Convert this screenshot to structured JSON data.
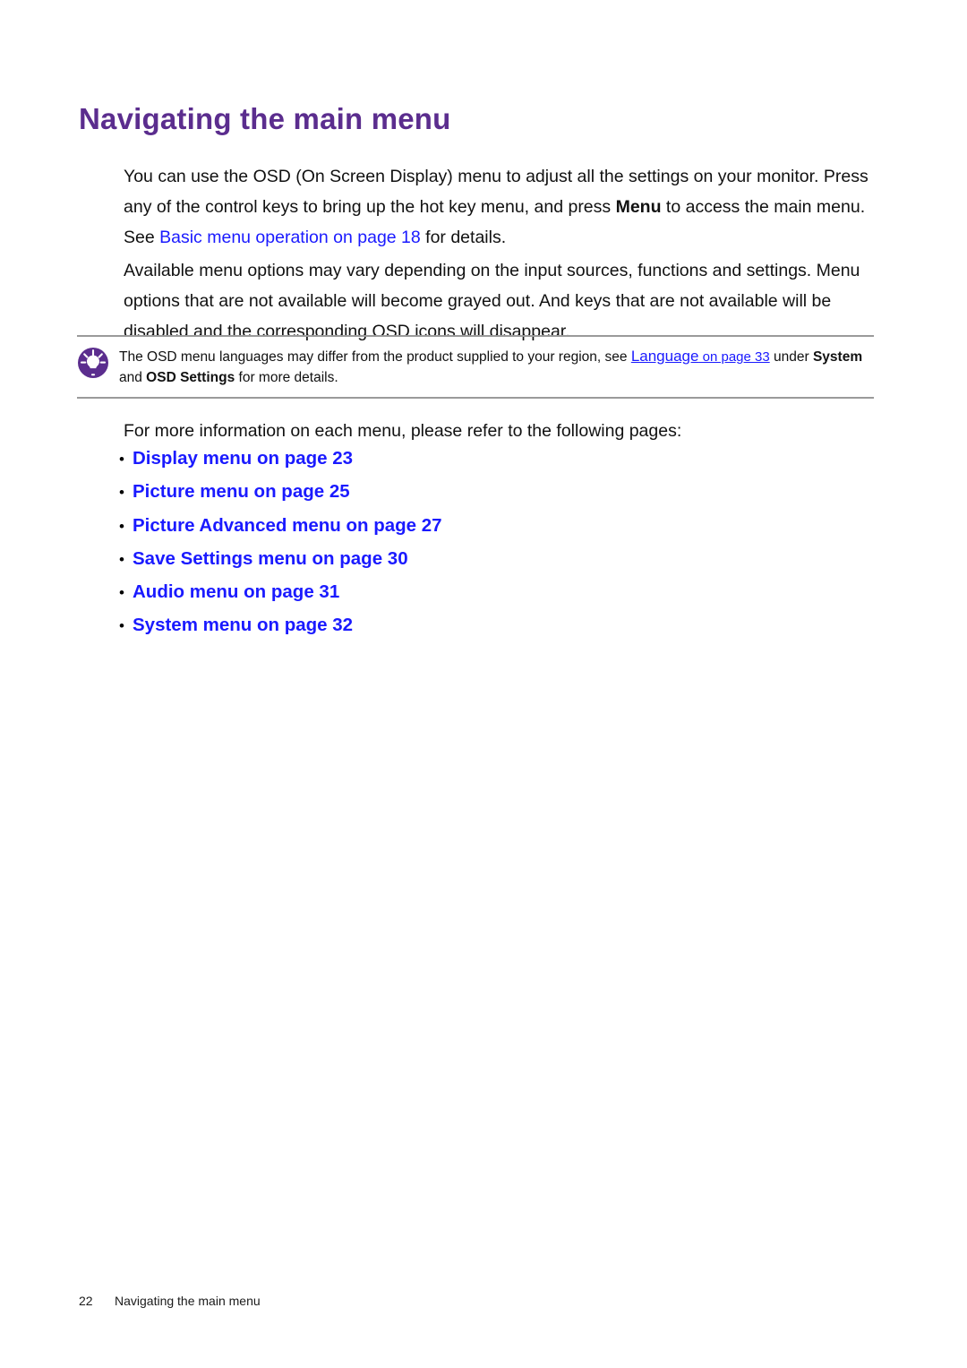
{
  "document": {
    "title": "Navigating the main menu",
    "title_color": "#5b2d8e",
    "link_color": "#1a1aff"
  },
  "intro": {
    "part1": "You can use the OSD (On Screen Display) menu to adjust all the settings on your monitor. Press any of the control keys to bring up the hot key menu, and press ",
    "bold_menu": "Menu",
    "part2": " to access the main menu. See ",
    "link": "Basic menu operation on page 18",
    "part3": " for details."
  },
  "availability": {
    "text": "Available menu options may vary depending on the input sources, functions and settings. Menu options that are not available will become grayed out. And keys that are not available will be disabled and the corresponding OSD icons will disappear."
  },
  "note": {
    "icon": "lightbulb-tip-icon",
    "icon_color": "#5b2d8e",
    "part1": "The OSD menu languages may differ from the product supplied to your region, see ",
    "link_main": "Language",
    "link_sub": " on page 33",
    "part2": " under ",
    "bold1": "System",
    "part3": " and ",
    "bold2": "OSD Settings",
    "part4": " for more details."
  },
  "list_intro": "For more information on each menu, please refer to the following pages:",
  "menu_links": [
    {
      "bullet": "•",
      "label": "Display menu on page 23"
    },
    {
      "bullet": "•",
      "label": "Picture menu on page 25"
    },
    {
      "bullet": "•",
      "label": "Picture Advanced menu on page 27"
    },
    {
      "bullet": "•",
      "label": "Save Settings menu on page 30"
    },
    {
      "bullet": "•",
      "label": "Audio menu on page 31"
    },
    {
      "bullet": "•",
      "label": "System menu on page 32"
    }
  ],
  "footer": {
    "page_number": "22",
    "section": "Navigating the main menu"
  }
}
